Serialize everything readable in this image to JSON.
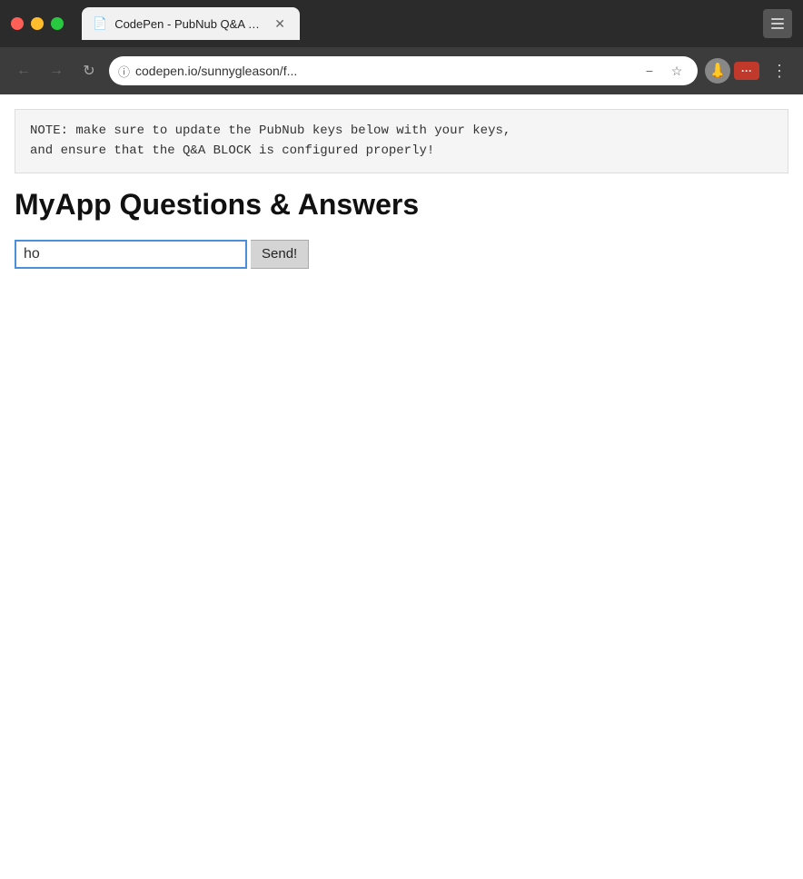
{
  "titlebar": {
    "tab": {
      "title": "CodePen - PubNub Q&A UI w/",
      "full_title": "CodePen - PubNub Q&A UI w/"
    }
  },
  "addressbar": {
    "url": "codepen.io/sunnygleason/f...",
    "full_url": "codepen.io/sunnygleason/f..."
  },
  "page": {
    "note": "NOTE: make sure to update the PubNub keys below with your keys,\nand ensure that the Q&A BLOCK is configured properly!",
    "heading": "MyApp Questions & Answers",
    "input_value": "ho",
    "send_button": "Send!"
  }
}
